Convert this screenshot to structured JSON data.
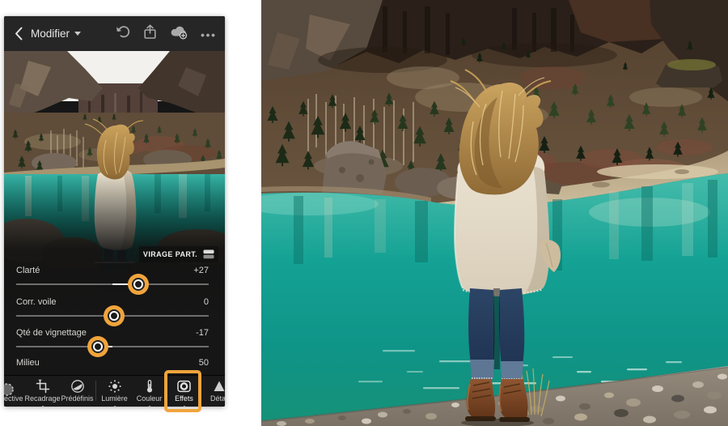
{
  "accent_color": "#F0A43C",
  "header": {
    "title": "Modifier",
    "icons": [
      "back",
      "undo",
      "share",
      "cloud-sync",
      "more"
    ]
  },
  "tone_chip": {
    "label": "VIRAGE PART."
  },
  "sliders": [
    {
      "label": "Clarté",
      "value": "+27",
      "pct": 63.4
    },
    {
      "label": "Corr. voile",
      "value": "0",
      "pct": 50.8
    },
    {
      "label": "Qté de vignettage",
      "value": "-17",
      "pct": 42.5
    },
    {
      "label": "Milieu",
      "value": "50",
      "pct": 52,
      "partial": true
    }
  ],
  "toolbar": {
    "items": [
      {
        "label": "ective",
        "icon": "selective-brush"
      },
      {
        "label": "Recadrage",
        "icon": "crop-rotate",
        "dot": true
      },
      {
        "label": "Prédéfinis",
        "icon": "presets-duotone"
      },
      {
        "label": "Lumière",
        "icon": "light-sun",
        "dot": true
      },
      {
        "label": "Couleur",
        "icon": "color-thermometer",
        "dot": true
      },
      {
        "label": "Effets",
        "icon": "effects-vignette",
        "highlighted": true,
        "dot": true
      },
      {
        "label": "Détai",
        "icon": "detail-triangle"
      }
    ]
  }
}
